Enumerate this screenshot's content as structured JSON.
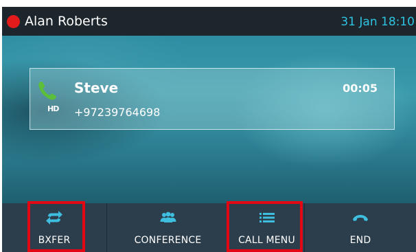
{
  "status_bar": {
    "user_name": "Alan Roberts",
    "date_time": "31 Jan 18:10"
  },
  "call": {
    "caller_name": "Steve",
    "caller_number": "+97239764698",
    "duration": "00:05",
    "hd_badge": "HD"
  },
  "softkeys": [
    {
      "label": "BXFER",
      "icon": "transfer-icon"
    },
    {
      "label": "CONFERENCE",
      "icon": "conference-icon"
    },
    {
      "label": "CALL MENU",
      "icon": "menu-icon"
    },
    {
      "label": "END",
      "icon": "end-call-icon"
    }
  ],
  "colors": {
    "status_bar_bg": "#1c262c",
    "presence_dot": "#e31b1b",
    "date_time_text": "#2fc3e3",
    "softkey_bar_bg": "#2c3e4c",
    "icon_cyan": "#3fbfe0",
    "phone_green": "#5bbf3a",
    "highlight_red": "#e30613"
  }
}
